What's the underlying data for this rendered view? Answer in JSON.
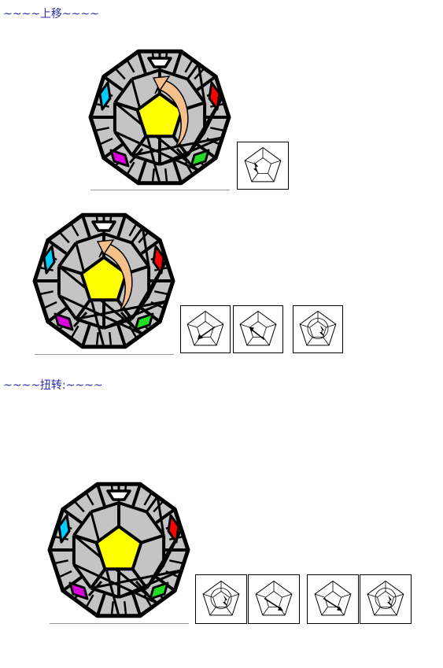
{
  "sections": [
    {
      "heading": "~~~~上移~~~~"
    },
    {
      "heading": "~~~~扭转:~~~~"
    }
  ],
  "colors": {
    "edge": "#000000",
    "body": "#c4c4c4",
    "yellow": "#ffff00",
    "cyan": "#00ccff",
    "red": "#ff0000",
    "magenta": "#dd00dd",
    "green": "#22dd22",
    "arrow": "#f5c08a",
    "heading": "#2a2aa8"
  },
  "figures": [
    {
      "name": "figure-1",
      "arrow": true,
      "icons": [
        {
          "group": 1,
          "mark": "left-bolt"
        }
      ]
    },
    {
      "name": "figure-2",
      "arrow": true,
      "icons": [
        {
          "group": 1,
          "mark": "arrow-down-left"
        },
        {
          "group": 1,
          "mark": "arrow-up-left"
        },
        {
          "group": 2,
          "mark": "circle-bolt"
        }
      ]
    },
    {
      "name": "figure-3",
      "arrow": false,
      "icons": [
        {
          "group": 1,
          "mark": "circle-bolt"
        },
        {
          "group": 1,
          "mark": "arrow-down-right"
        },
        {
          "group": 2,
          "mark": "arrow-down-right"
        },
        {
          "group": 2,
          "mark": "circle-bolt"
        }
      ]
    }
  ]
}
